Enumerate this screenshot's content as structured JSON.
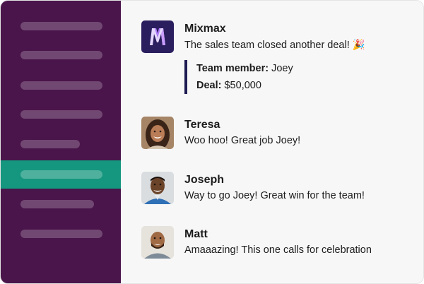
{
  "sidebar": {
    "items": [
      {
        "active": false
      },
      {
        "active": false
      },
      {
        "active": false
      },
      {
        "active": false
      },
      {
        "active": false
      },
      {
        "active": true
      },
      {
        "active": false
      },
      {
        "active": false
      }
    ]
  },
  "messages": [
    {
      "name": "Mixmax",
      "text": "The sales team closed another deal! 🎉",
      "attachment": {
        "rows": [
          {
            "label": "Team member:",
            "value": " Joey"
          },
          {
            "label": "Deal:",
            "value": " $50,000"
          }
        ]
      }
    },
    {
      "name": "Teresa",
      "text": "Woo hoo! Great job Joey!"
    },
    {
      "name": "Joseph",
      "text": "Way to go Joey! Great win for the team!"
    },
    {
      "name": "Matt",
      "text": "Amaaazing! This one calls for celebration"
    }
  ],
  "colors": {
    "sidebar_bg": "#4a154b",
    "sidebar_active": "#15967e",
    "main_bg": "#f7f7f7",
    "mixmax_logo_bg": "#2b1e5e",
    "quote_bar": "#1e1b52"
  },
  "icons": {
    "mixmax": "mixmax-logo-icon",
    "teresa": "teresa-avatar",
    "joseph": "joseph-avatar",
    "matt": "matt-avatar"
  }
}
